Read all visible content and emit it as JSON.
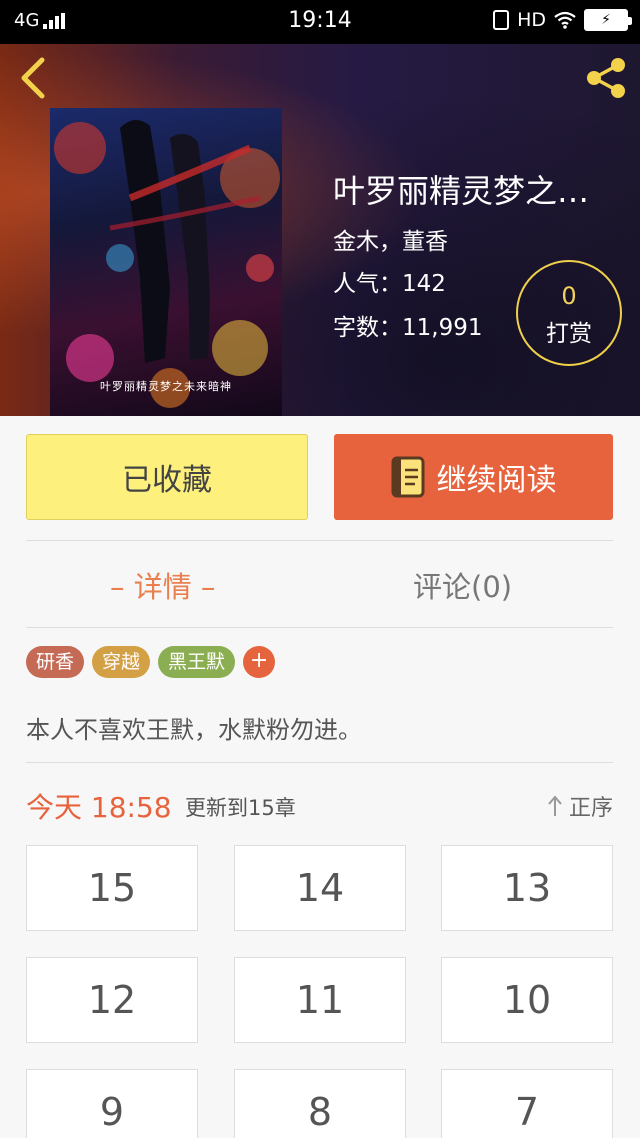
{
  "status_bar": {
    "network": "4G",
    "time": "19:14",
    "hd": "HD"
  },
  "book": {
    "title": "叶罗丽精灵梦之…",
    "authors": "金木，董香",
    "popularity_label": "人气：",
    "popularity_value": "142",
    "wordcount_label": "字数：",
    "wordcount_value": "11,991",
    "cover_caption": "叶罗丽精灵梦之未来暗神"
  },
  "tip": {
    "count": "0",
    "label": "打赏"
  },
  "actions": {
    "favorite_label": "已收藏",
    "read_label": "继续阅读"
  },
  "tabs": {
    "details": "– 详情 –",
    "comments": "评论(0)"
  },
  "tags": [
    {
      "label": "研香",
      "color": "#c46a55"
    },
    {
      "label": "穿越",
      "color": "#d4a046"
    },
    {
      "label": "黑王默",
      "color": "#8cae52"
    }
  ],
  "tag_add": "+",
  "intro": "本人不喜欢王默，水默粉勿进。",
  "update": {
    "time": "今天 18:58",
    "info": "更新到15章",
    "sort_label": "正序"
  },
  "chapters": [
    "15",
    "14",
    "13",
    "12",
    "11",
    "10",
    "9",
    "8",
    "7"
  ],
  "colors": {
    "accent": "#e7633d",
    "favorite_bg": "#fdf07d",
    "tip_ring": "#f0d04a"
  }
}
